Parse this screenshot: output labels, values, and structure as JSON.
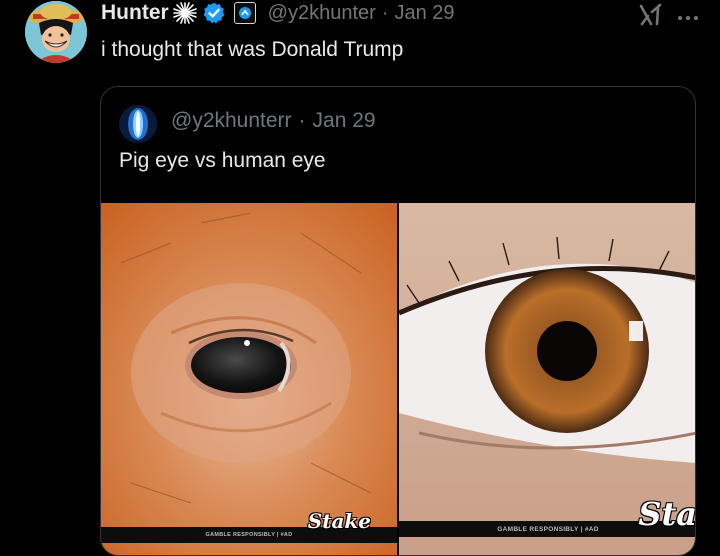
{
  "tweet": {
    "display_name": "Hunter",
    "handle": "@y2khunter",
    "separator": "·",
    "date": "Jan 29",
    "text": "i thought that was Donald Trump"
  },
  "quoted_tweet": {
    "handle": "@y2khunterr",
    "separator": "·",
    "date": "Jan 29",
    "text": "Pig eye vs human eye",
    "images": [
      {
        "ad_caption": "GAMBLE RESPONSIBLY  |  #AD",
        "watermark": "Stake"
      },
      {
        "ad_caption": "GAMBLE RESPONSIBLY  |  #AD",
        "watermark": "Sta"
      }
    ]
  },
  "icons": {
    "avatar": "luffy-avatar",
    "spark": "spark-burst-icon",
    "verified": "verified-badge-icon",
    "affiliate": "affiliate-badge-icon",
    "grok": "grok-icon",
    "more": "more-options-icon"
  },
  "colors": {
    "background": "#000000",
    "text": "#e7e9ea",
    "secondary_text": "#71767b",
    "verified": "#1d9bf0",
    "border": "#2f3336"
  }
}
